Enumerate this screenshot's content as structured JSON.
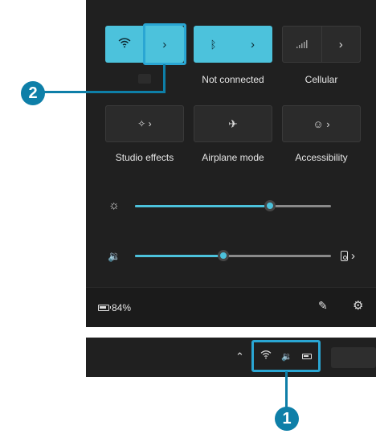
{
  "tiles": {
    "wifi": {
      "label": ""
    },
    "bluetooth": {
      "label": "Not connected"
    },
    "cellular": {
      "label": "Cellular"
    },
    "studio": {
      "label": "Studio effects"
    },
    "airplane": {
      "label": "Airplane mode"
    },
    "accessibility": {
      "label": "Accessibility"
    }
  },
  "sliders": {
    "brightness": {
      "value_percent": 69
    },
    "volume": {
      "value_percent": 45
    }
  },
  "battery": {
    "text": "84%"
  },
  "callouts": {
    "one": "1",
    "two": "2"
  },
  "colors": {
    "accent": "#4cc2dc",
    "callout": "#0e7fa8",
    "panel": "#202020"
  }
}
